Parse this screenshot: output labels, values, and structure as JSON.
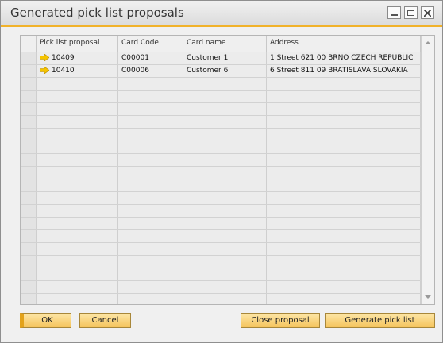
{
  "window": {
    "title": "Generated pick list proposals"
  },
  "table": {
    "columns": [
      "",
      "Pick list proposal",
      "Card Code",
      "Card name",
      "Address"
    ],
    "rows": [
      {
        "pick_list": "10409",
        "card_code": "C00001",
        "card_name": "Customer 1",
        "address": "1 Street  621 00 BRNO CZECH REPUBLIC"
      },
      {
        "pick_list": "10410",
        "card_code": "C00006",
        "card_name": "Customer 6",
        "address": "6 Street  811 09 BRATISLAVA SLOVAKIA"
      }
    ],
    "empty_rows": 18
  },
  "buttons": {
    "ok": "OK",
    "cancel": "Cancel",
    "close_proposal": "Close proposal",
    "generate_pick_list": "Generate pick list"
  },
  "colors": {
    "accent": "#f1b22a",
    "link_arrow": "#f5c400"
  }
}
